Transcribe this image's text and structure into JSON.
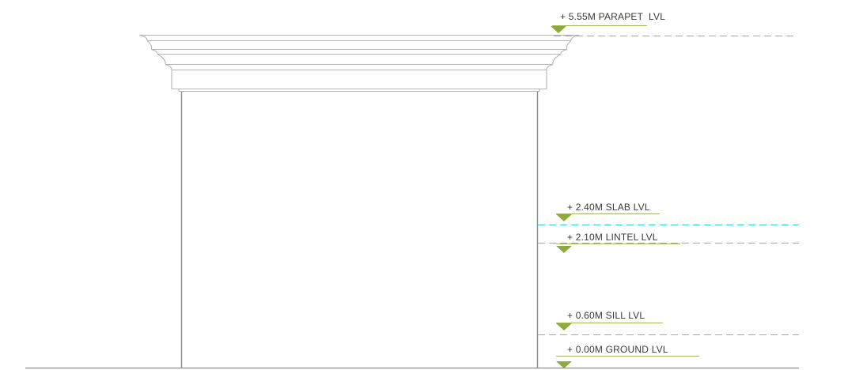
{
  "colors": {
    "line": "#8c8c8c",
    "cornice": "#b4b4b4",
    "level_text": "#3a3a3a",
    "marker": "#8faa3c",
    "marker_underline": "#a3bb5c",
    "datum_dash": "#3fd3d9"
  },
  "levels": [
    {
      "id": "parapet",
      "label": "+ 5.55M PARAPET  LVL"
    },
    {
      "id": "slab",
      "label": "+ 2.40M SLAB LVL"
    },
    {
      "id": "lintel",
      "label": "+ 2.10M LINTEL LVL"
    },
    {
      "id": "sill",
      "label": "+ 0.60M SILL LVL"
    },
    {
      "id": "ground",
      "label": "+ 0.00M GROUND LVL"
    }
  ]
}
